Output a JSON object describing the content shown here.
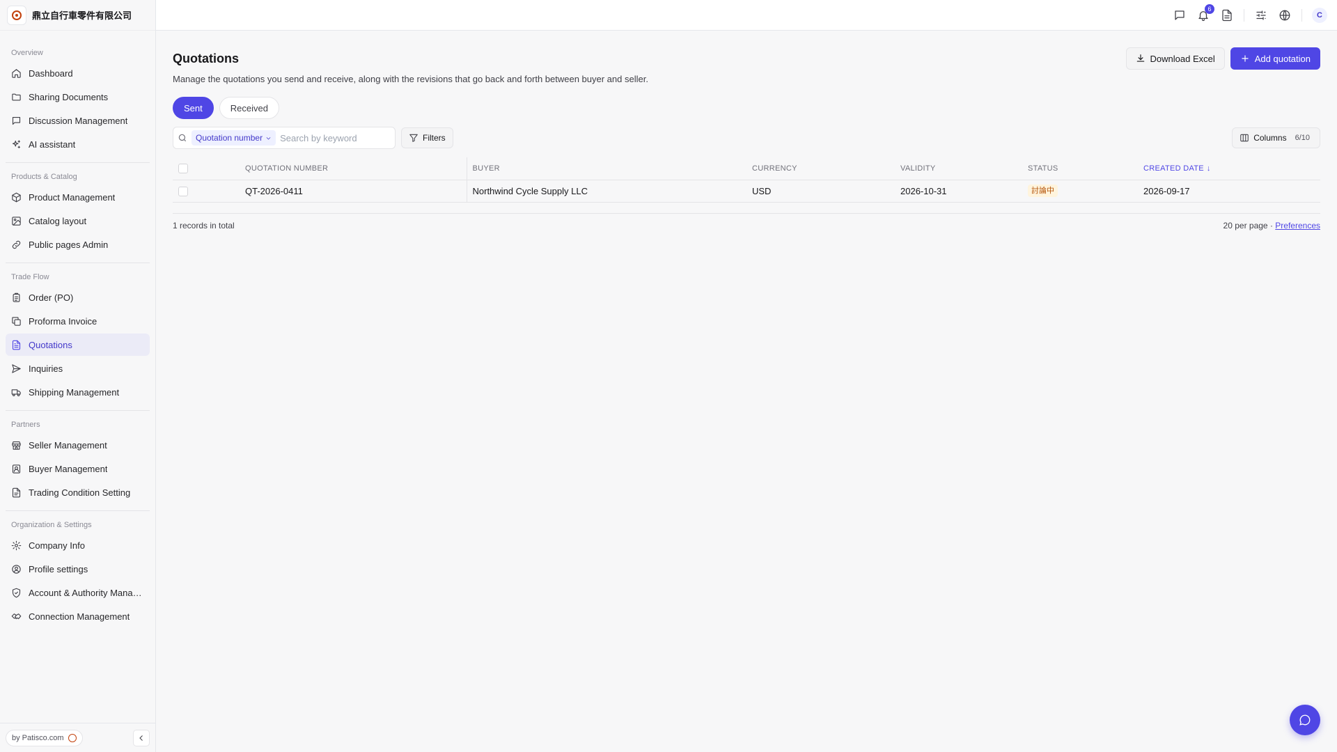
{
  "brand": {
    "company_name": "鼎立自行車零件有限公司",
    "logo_icon": "company-logo"
  },
  "sidebar": {
    "groups": [
      {
        "title": "Overview",
        "items": [
          {
            "label": "Dashboard",
            "icon": "home-icon"
          },
          {
            "label": "Sharing Documents",
            "icon": "folder-icon"
          },
          {
            "label": "Discussion Management",
            "icon": "message-icon"
          },
          {
            "label": "AI assistant",
            "icon": "sparkles-icon"
          }
        ]
      },
      {
        "title": "Products & Catalog",
        "items": [
          {
            "label": "Product Management",
            "icon": "box-icon"
          },
          {
            "label": "Catalog layout",
            "icon": "image-icon"
          },
          {
            "label": "Public pages Admin",
            "icon": "link-icon"
          }
        ]
      },
      {
        "title": "Trade Flow",
        "items": [
          {
            "label": "Order (PO)",
            "icon": "clipboard-icon"
          },
          {
            "label": "Proforma Invoice",
            "icon": "copy-icon"
          },
          {
            "label": "Quotations",
            "icon": "file-text-icon",
            "active": true
          },
          {
            "label": "Inquiries",
            "icon": "send-icon"
          },
          {
            "label": "Shipping Management",
            "icon": "truck-icon"
          }
        ]
      },
      {
        "title": "Partners",
        "items": [
          {
            "label": "Seller Management",
            "icon": "store-icon"
          },
          {
            "label": "Buyer Management",
            "icon": "contact-icon"
          },
          {
            "label": "Trading Condition Setting",
            "icon": "file-icon"
          }
        ]
      },
      {
        "title": "Organization & Settings",
        "items": [
          {
            "label": "Company Info",
            "icon": "gear-icon"
          },
          {
            "label": "Profile settings",
            "icon": "user-circle-icon"
          },
          {
            "label": "Account & Authority Mana…",
            "icon": "shield-icon"
          },
          {
            "label": "Connection Management",
            "icon": "handshake-icon"
          }
        ]
      }
    ],
    "footer": {
      "byline": "by Patisco.com"
    }
  },
  "topbar": {
    "notification_count": "6",
    "avatar_initial": "C"
  },
  "page": {
    "title": "Quotations",
    "description": "Manage the quotations you send and receive, along with the revisions that go back and forth between buyer and seller.",
    "download_label": "Download Excel",
    "add_label": "Add quotation",
    "tabs": [
      {
        "label": "Sent",
        "active": true
      },
      {
        "label": "Received",
        "active": false
      }
    ]
  },
  "toolbar": {
    "search_scope": "Quotation number",
    "search_placeholder": "Search by keyword",
    "filters_label": "Filters",
    "columns_label": "Columns",
    "columns_count": "6/10"
  },
  "table": {
    "columns": [
      "Quotation number",
      "Buyer",
      "Currency",
      "Validity",
      "Status",
      "Created date"
    ],
    "sorted_column": "Created date",
    "rows": [
      {
        "quotation_number": "QT-2026-0411",
        "buyer": "Northwind Cycle Supply LLC",
        "currency": "USD",
        "validity": "2026-10-31",
        "status": "討論中",
        "created_date": "2026-09-17"
      }
    ],
    "total_text": "1 records in total",
    "per_page": "20 per page",
    "separator": "·",
    "preferences_label": "Preferences"
  },
  "colors": {
    "accent": "#4f46e5",
    "status_badge_bg": "#fff4dd",
    "status_badge_text": "#b45309"
  }
}
